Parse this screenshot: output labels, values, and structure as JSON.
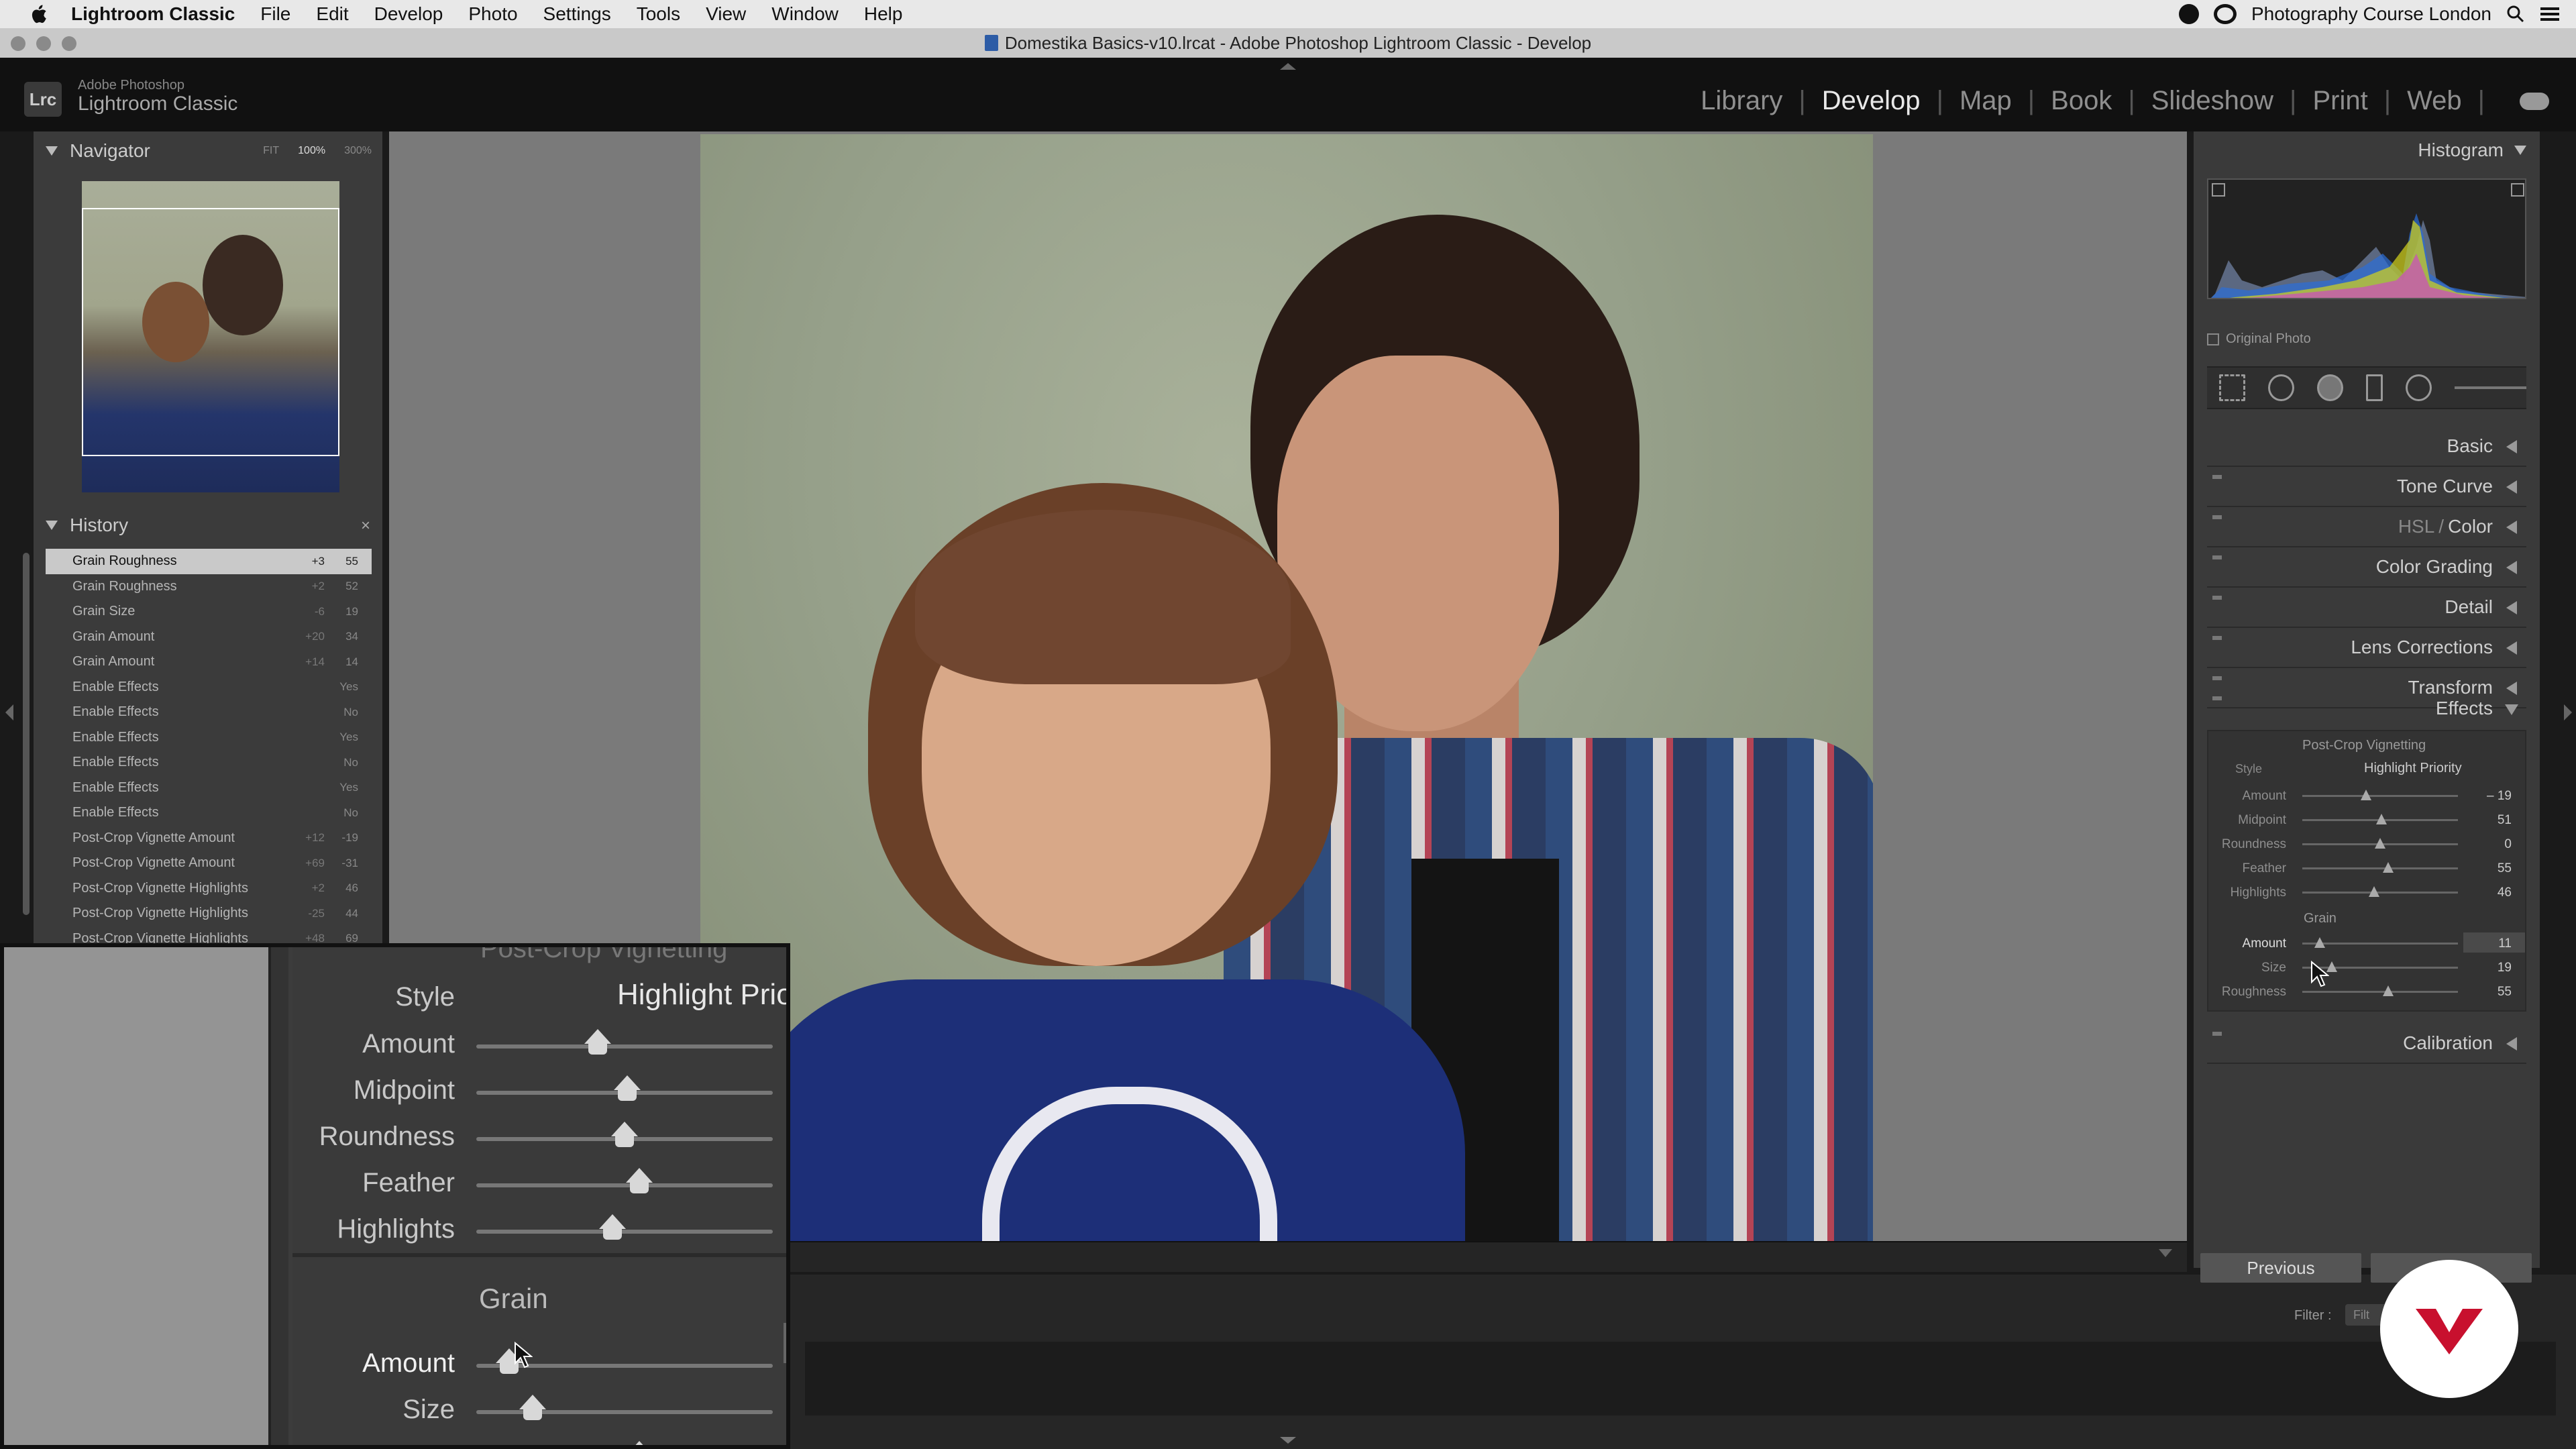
{
  "menubar": {
    "app_name": "Lightroom Classic",
    "items": [
      "File",
      "Edit",
      "Develop",
      "Photo",
      "Settings",
      "Tools",
      "View",
      "Window",
      "Help"
    ],
    "right_text": "Photography Course London"
  },
  "window": {
    "title": "Domestika Basics-v10.lrcat - Adobe Photoshop Lightroom Classic - Develop"
  },
  "brand": {
    "logo": "Lrc",
    "line1": "Adobe Photoshop",
    "line2": "Lightroom Classic"
  },
  "modules": [
    "Library",
    "Develop",
    "Map",
    "Book",
    "Slideshow",
    "Print",
    "Web"
  ],
  "active_module": "Develop",
  "navigator": {
    "title": "Navigator",
    "zoom_options": [
      "FIT",
      "100%",
      "300%"
    ],
    "active_zoom": "100%"
  },
  "history": {
    "title": "History",
    "close_glyph": "×",
    "items": [
      {
        "name": "Grain Roughness",
        "delta": "+3",
        "value": "55",
        "selected": true
      },
      {
        "name": "Grain Roughness",
        "delta": "+2",
        "value": "52"
      },
      {
        "name": "Grain Size",
        "delta": "-6",
        "value": "19"
      },
      {
        "name": "Grain Amount",
        "delta": "+20",
        "value": "34"
      },
      {
        "name": "Grain Amount",
        "delta": "+14",
        "value": "14"
      },
      {
        "name": "Enable Effects",
        "delta": "",
        "value": "Yes"
      },
      {
        "name": "Enable Effects",
        "delta": "",
        "value": "No"
      },
      {
        "name": "Enable Effects",
        "delta": "",
        "value": "Yes"
      },
      {
        "name": "Enable Effects",
        "delta": "",
        "value": "No"
      },
      {
        "name": "Enable Effects",
        "delta": "",
        "value": "Yes"
      },
      {
        "name": "Enable Effects",
        "delta": "",
        "value": "No"
      },
      {
        "name": "Post-Crop Vignette Amount",
        "delta": "+12",
        "value": "-19"
      },
      {
        "name": "Post-Crop Vignette Amount",
        "delta": "+69",
        "value": "-31"
      },
      {
        "name": "Post-Crop Vignette Highlights",
        "delta": "+2",
        "value": "46"
      },
      {
        "name": "Post-Crop Vignette Highlights",
        "delta": "-25",
        "value": "44"
      },
      {
        "name": "Post-Crop Vignette Highlights",
        "delta": "+48",
        "value": "69"
      }
    ]
  },
  "right_panel": {
    "histogram_title": "Histogram",
    "original_photo_label": "Original Photo",
    "sections": [
      "Basic",
      "Tone Curve",
      "HSL",
      "Color",
      "Color Grading",
      "Detail",
      "Lens Corrections",
      "Transform",
      "Effects",
      "Calibration"
    ],
    "effects": {
      "vignette_title": "Post-Crop Vignetting",
      "style_label": "Style",
      "style_value": "Highlight Priority",
      "vignette_sliders": [
        {
          "label": "Amount",
          "value": "– 19",
          "pos": 0.41
        },
        {
          "label": "Midpoint",
          "value": "51",
          "pos": 0.51
        },
        {
          "label": "Roundness",
          "value": "0",
          "pos": 0.5
        },
        {
          "label": "Feather",
          "value": "55",
          "pos": 0.55
        },
        {
          "label": "Highlights",
          "value": "46",
          "pos": 0.46
        }
      ],
      "grain_title": "Grain",
      "grain_sliders": [
        {
          "label": "Amount",
          "value": "11",
          "pos": 0.11,
          "active": true
        },
        {
          "label": "Size",
          "value": "19",
          "pos": 0.19
        },
        {
          "label": "Roughness",
          "value": "55",
          "pos": 0.55
        }
      ]
    },
    "previous_label": "Previous"
  },
  "filmstrip": {
    "filter_label": "Filter :",
    "filter_value": "Filt"
  },
  "zoom_overlay": {
    "cut_title": "Post-Crop Vignetting",
    "style_label": "Style",
    "style_value": "Highlight Prior",
    "sliders": [
      {
        "label": "Amount",
        "pos": 0.41
      },
      {
        "label": "Midpoint",
        "pos": 0.51
      },
      {
        "label": "Roundness",
        "pos": 0.5
      },
      {
        "label": "Feather",
        "pos": 0.55
      },
      {
        "label": "Highlights",
        "pos": 0.46
      }
    ],
    "grain_title": "Grain",
    "grain_sliders": [
      {
        "label": "Amount",
        "pos": 0.11,
        "active": true
      },
      {
        "label": "Size",
        "pos": 0.19
      },
      {
        "label": "Roughness",
        "pos": 0.55
      }
    ]
  },
  "colors": {
    "accent_badge": "#c8102e",
    "panel_bg": "#3a3a3a",
    "selected_row": "#c9c9c9"
  }
}
